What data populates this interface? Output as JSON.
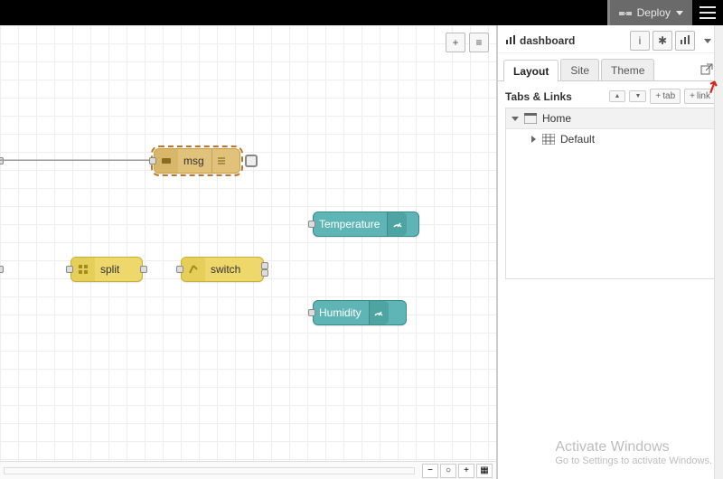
{
  "header": {
    "deploy_label": "Deploy"
  },
  "canvas": {
    "toolbar": {
      "add_tooltip": "+",
      "list_tooltip": "≡"
    },
    "footer": {
      "reset": "○",
      "minus": "−",
      "plus": "+",
      "map": "▦"
    },
    "nodes": {
      "msg": {
        "label": "msg"
      },
      "split": {
        "label": "split"
      },
      "switch": {
        "label": "switch"
      },
      "temperature": {
        "label": "Temperature"
      },
      "humidity": {
        "label": "Humidity"
      }
    }
  },
  "sidebar": {
    "title": "dashboard",
    "tabs": {
      "layout": "Layout",
      "site": "Site",
      "theme": "Theme"
    },
    "section_title": "Tabs & Links",
    "btn_up": "▲",
    "btn_down": "▼",
    "btn_add_tab": "tab",
    "btn_add_link": "link",
    "tree": {
      "home": "Home",
      "default": "Default"
    }
  },
  "watermark": {
    "line1": "Activate Windows",
    "line2": "Go to Settings to activate Windows."
  }
}
